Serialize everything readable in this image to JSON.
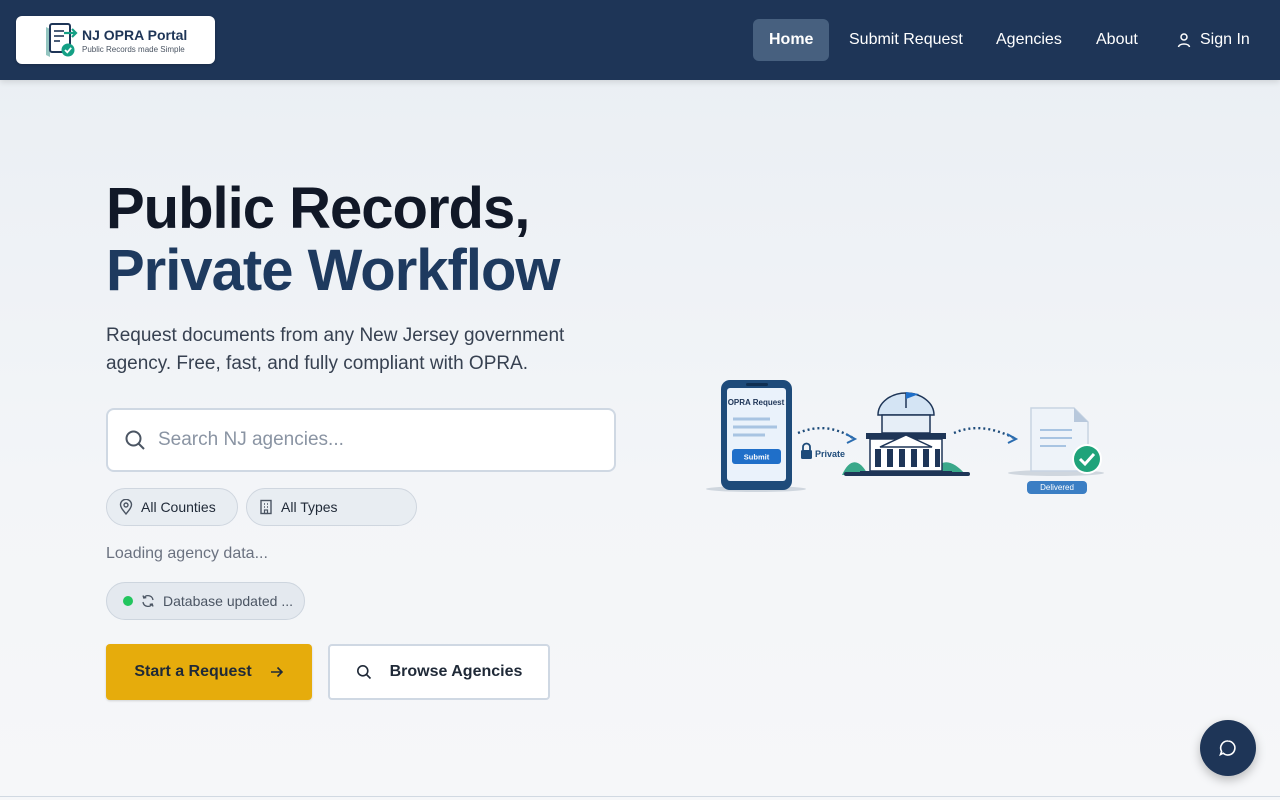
{
  "header": {
    "logo": {
      "title": "NJ OPRA Portal",
      "tagline": "Public Records made Simple",
      "icon": "document-check-icon"
    },
    "nav": [
      {
        "label": "Home",
        "active": true
      },
      {
        "label": "Submit Request",
        "active": false
      },
      {
        "label": "Agencies",
        "active": false
      },
      {
        "label": "About",
        "active": false
      }
    ],
    "sign_in": {
      "label": "Sign In",
      "icon": "user-icon"
    },
    "background": "#1e3557"
  },
  "hero": {
    "title_line1": "Public Records,",
    "title_line2": "Private Workflow",
    "subtitle": "Request documents from any New Jersey government agency. Free, fast, and fully compliant with OPRA.",
    "search": {
      "placeholder": "Search NJ agencies...",
      "value": "",
      "icon": "search-icon"
    },
    "filters": [
      {
        "label": "All Counties",
        "icon": "map-pin-icon"
      },
      {
        "label": "All Types",
        "icon": "building-icon"
      }
    ],
    "loading_text": "Loading agency data...",
    "db_status": {
      "label": "Database updated ...",
      "status_color": "#22c55e",
      "icon": "refresh-icon"
    },
    "buttons": {
      "primary": {
        "label": "Start a Request",
        "icon": "arrow-right-icon",
        "color": "#e6ac0c"
      },
      "secondary": {
        "label": "Browse Agencies",
        "icon": "search-icon"
      }
    }
  },
  "illustration": {
    "phone_title": "OPRA Request",
    "phone_button": "Submit",
    "lock_label": "Private",
    "delivered_label": "Delivered"
  },
  "chat": {
    "icon": "chat-bubble-icon"
  }
}
